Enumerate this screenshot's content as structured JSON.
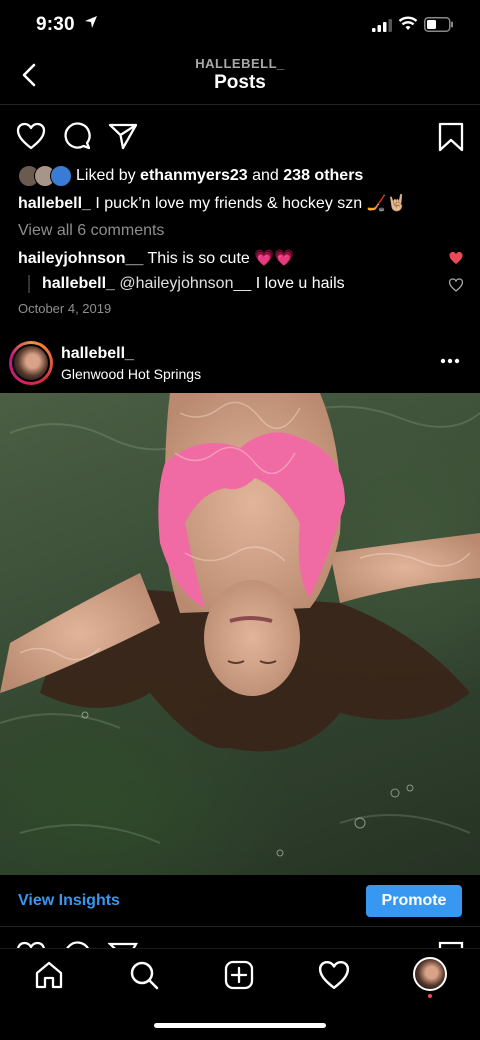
{
  "status_bar": {
    "time": "9:30"
  },
  "header": {
    "username": "HALLEBELL_",
    "title": "Posts"
  },
  "post": {
    "likes": {
      "prefix": "Liked by",
      "user": "ethanmyers23",
      "and": "and",
      "others": "238 others"
    },
    "caption": {
      "username": "hallebell_",
      "text": "I puck’n love my friends & hockey szn 🏒🤘🏼"
    },
    "view_all": "View all 6 comments",
    "comments": [
      {
        "username": "haileyjohnson__",
        "text": "This is so cute 💗💗"
      }
    ],
    "reply": {
      "username": "hallebell_",
      "mention": "@haileyjohnson__",
      "text": "I love u hails"
    },
    "date": "October 4, 2019"
  },
  "post_header": {
    "username": "hallebell_",
    "location": "Glenwood Hot Springs"
  },
  "insights": {
    "view_label": "View Insights",
    "promote_label": "Promote"
  },
  "colors": {
    "accent": "#3897f0",
    "heart": "#ed4956",
    "muted": "#8e8e8e"
  },
  "tabs": [
    "home-icon",
    "search-icon",
    "new-post-icon",
    "activity-icon",
    "profile"
  ]
}
